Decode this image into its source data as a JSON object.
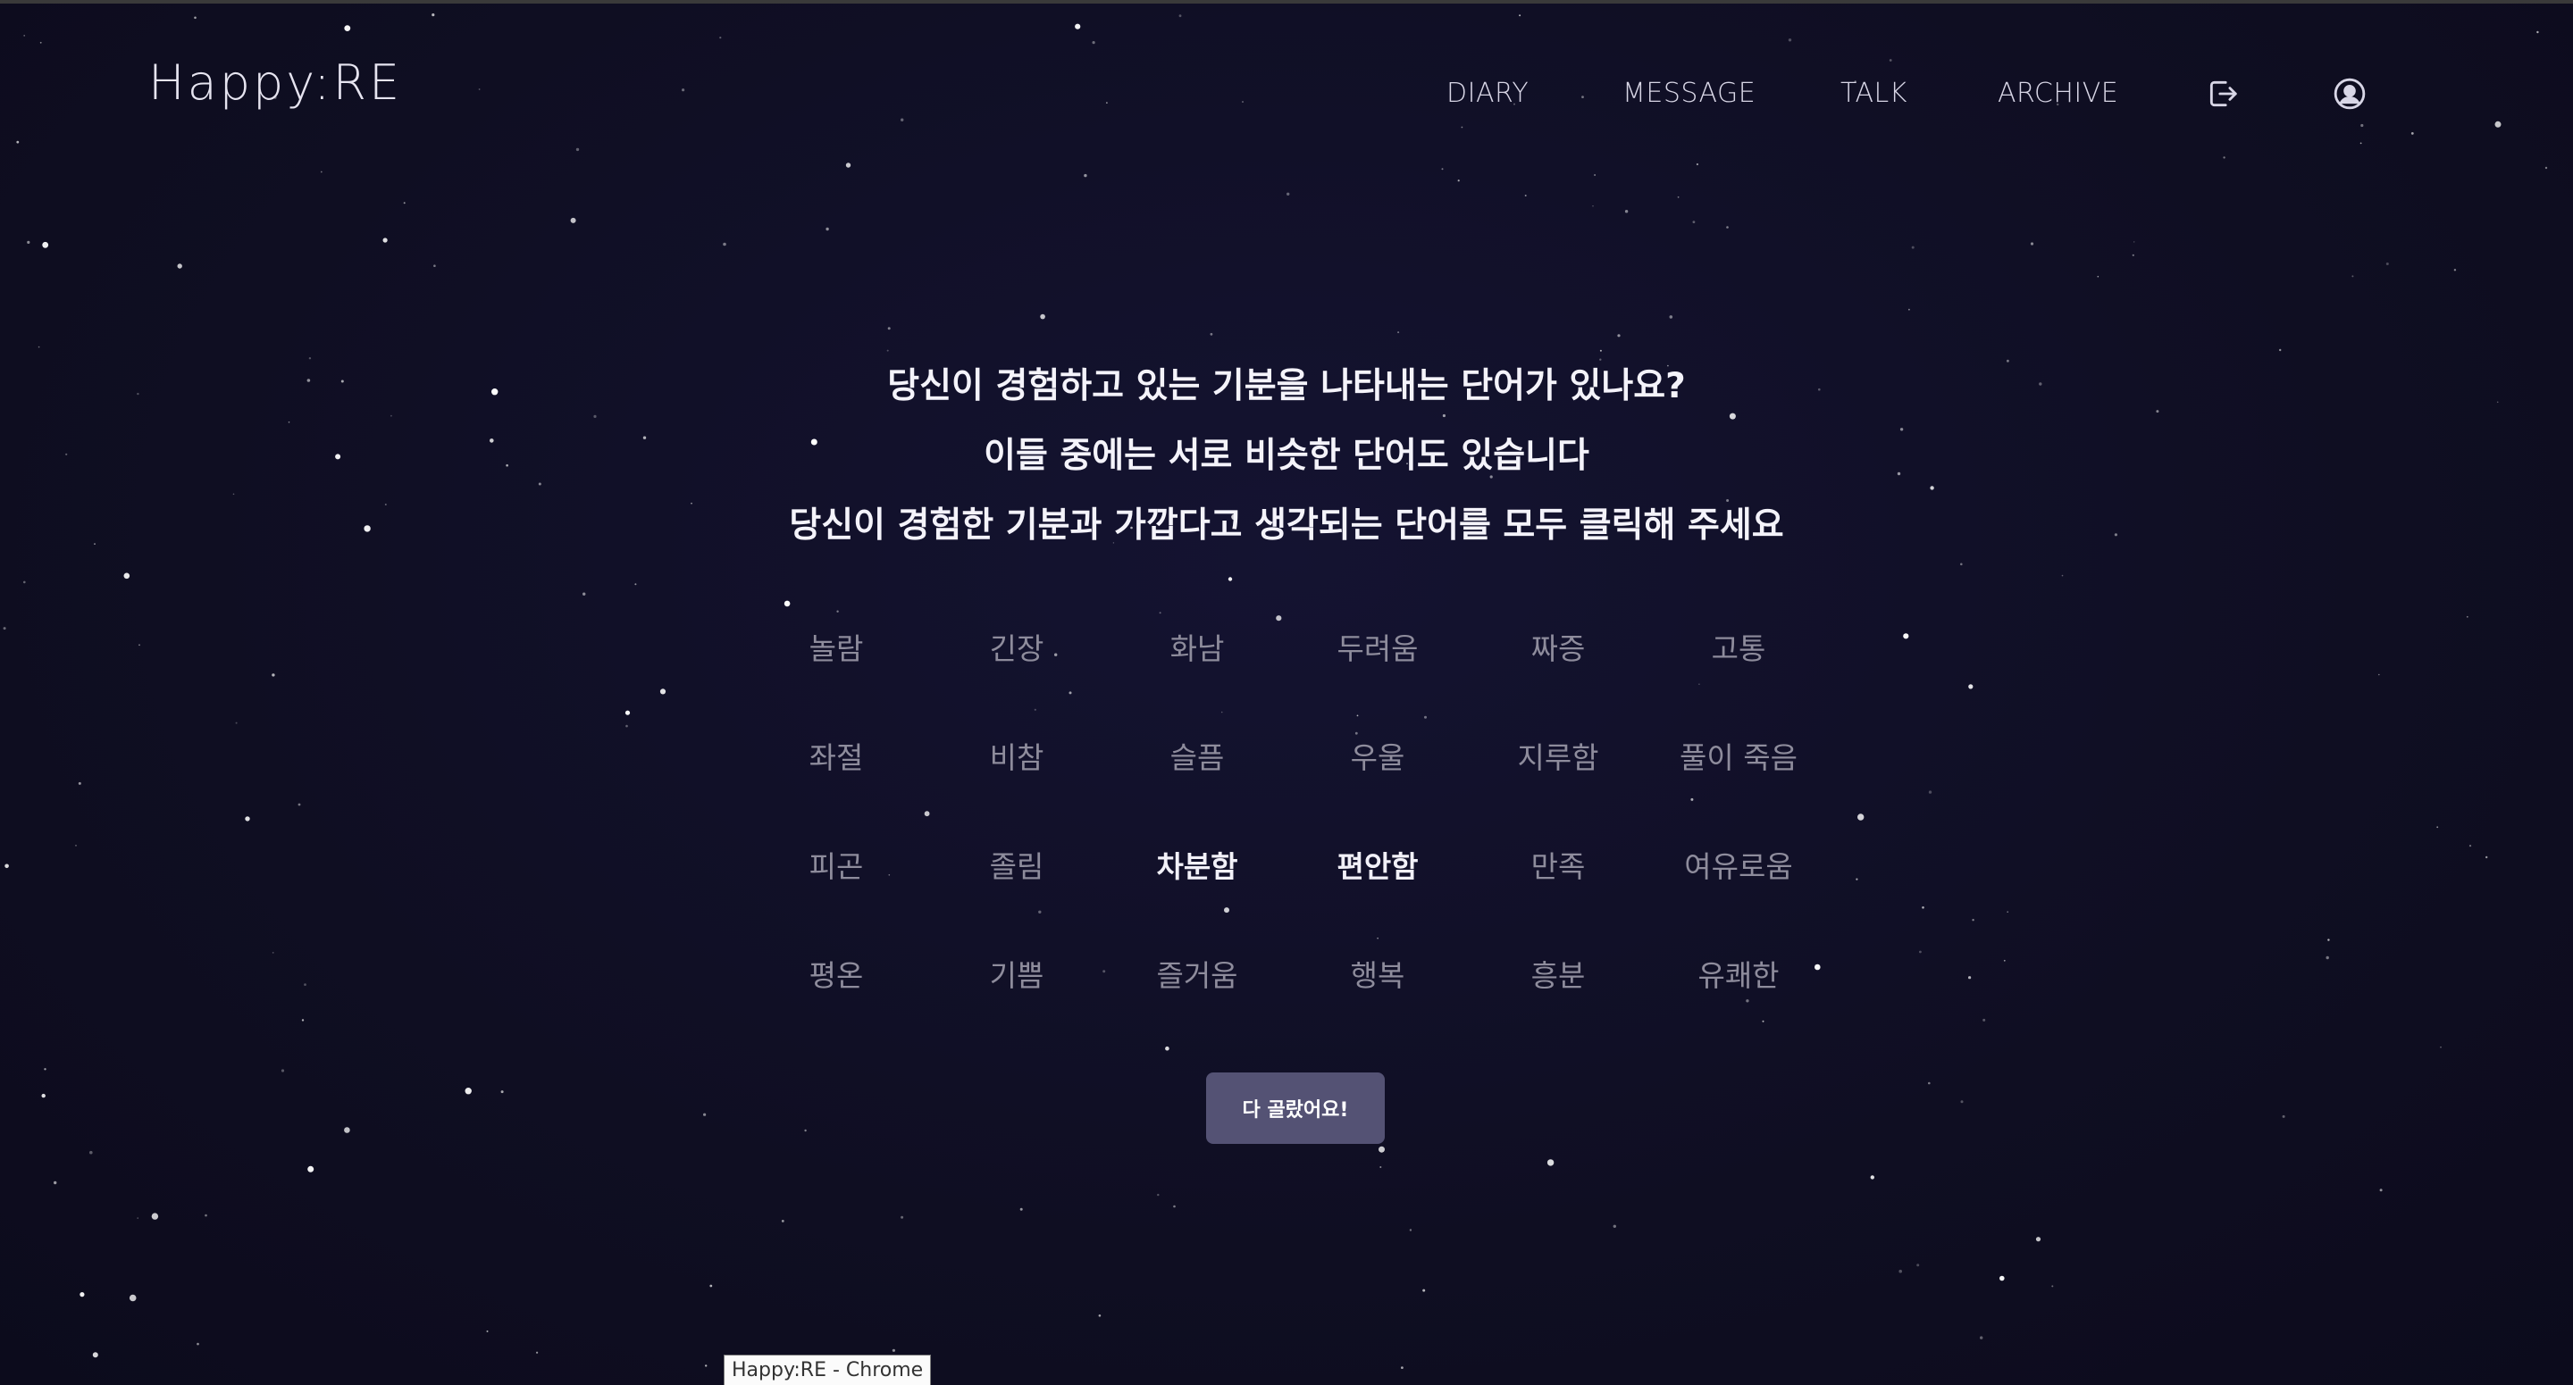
{
  "header": {
    "logo": "Happy:RE",
    "nav": [
      {
        "label": "DIARY"
      },
      {
        "label": "MESSAGE"
      },
      {
        "label": "TALK"
      },
      {
        "label": "ARCHIVE"
      }
    ],
    "icons": [
      "logout-icon",
      "user-account-icon"
    ]
  },
  "prompt": {
    "line1": "당신이 경험하고 있는 기분을 나타내는 단어가 있나요?",
    "line2": "이들 중에는 서로 비슷한 단어도 있습니다",
    "line3": "당신이 경험한 기분과 가깝다고 생각되는 단어를 모두 클릭해 주세요"
  },
  "emotion_words": [
    {
      "label": "놀람",
      "selected": false
    },
    {
      "label": "긴장",
      "selected": false
    },
    {
      "label": "화남",
      "selected": false
    },
    {
      "label": "두려움",
      "selected": false
    },
    {
      "label": "짜증",
      "selected": false
    },
    {
      "label": "고통",
      "selected": false
    },
    {
      "label": "좌절",
      "selected": false
    },
    {
      "label": "비참",
      "selected": false
    },
    {
      "label": "슬픔",
      "selected": false
    },
    {
      "label": "우울",
      "selected": false
    },
    {
      "label": "지루함",
      "selected": false
    },
    {
      "label": "풀이 죽음",
      "selected": false
    },
    {
      "label": "피곤",
      "selected": false
    },
    {
      "label": "졸림",
      "selected": false
    },
    {
      "label": "차분함",
      "selected": true
    },
    {
      "label": "편안함",
      "selected": true
    },
    {
      "label": "만족",
      "selected": false
    },
    {
      "label": "여유로움",
      "selected": false
    },
    {
      "label": "평온",
      "selected": false
    },
    {
      "label": "기쁨",
      "selected": false
    },
    {
      "label": "즐거움",
      "selected": false
    },
    {
      "label": "행복",
      "selected": false
    },
    {
      "label": "흥분",
      "selected": false
    },
    {
      "label": "유쾌한",
      "selected": false
    }
  ],
  "done_button": "다 골랐어요!",
  "tooltip": "Happy:RE - Chrome",
  "colors": {
    "background": "#0f0e22",
    "text_unselected": "#8e8c9c",
    "text_selected": "#f2f1f8",
    "button": "#545274"
  }
}
